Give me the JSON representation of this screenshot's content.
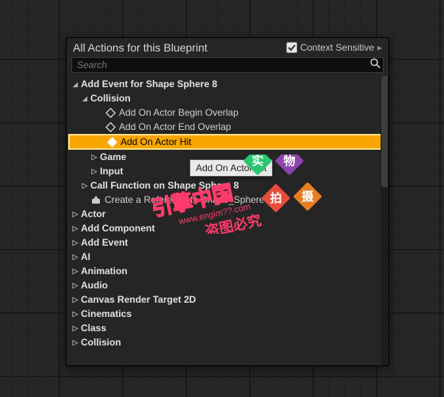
{
  "panel": {
    "title": "All Actions for this Blueprint",
    "context_sensitive_label": "Context Sensitive",
    "context_sensitive_checked": true
  },
  "search": {
    "placeholder": "Search"
  },
  "tree": {
    "shape_group": "Add Event for Shape Sphere 8",
    "collision": "Collision",
    "ev_begin": "Add On Actor Begin Overlap",
    "ev_end": "Add On Actor End Overlap",
    "ev_hit": "Add On Actor Hit",
    "game": "Game",
    "input": "Input",
    "call_fn": "Call Function on Shape Sphere 8",
    "create_ref": "Create a Reference to Shape_Sphere",
    "categories": [
      "Actor",
      "Add Component",
      "Add Event",
      "AI",
      "Animation",
      "Audio",
      "Canvas Render Target 2D",
      "Cinematics",
      "Class",
      "Collision"
    ]
  },
  "tooltip": "Add On Actor Hit",
  "watermark": {
    "line1": "引擎中国",
    "line2": "www.engim??.com",
    "line3": "盗图必究",
    "stamps": [
      "实",
      "物",
      "拍",
      "摄"
    ]
  }
}
